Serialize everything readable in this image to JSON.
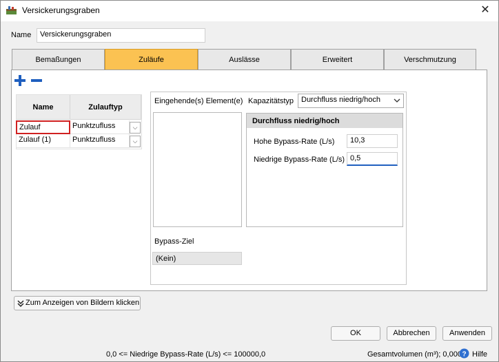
{
  "window": {
    "title": "Versickerungsgraben",
    "app_icon": "package-icon",
    "close": "✕"
  },
  "name_field": {
    "label": "Name",
    "value": "Versickerungsgraben"
  },
  "tabs": [
    {
      "label": "Bemaßungen"
    },
    {
      "label": "Zuläufe"
    },
    {
      "label": "Auslässe"
    },
    {
      "label": "Erweitert"
    },
    {
      "label": "Verschmutzung"
    }
  ],
  "active_tab": "Zuläufe",
  "toolbar": {
    "add": "+",
    "remove": "−"
  },
  "inflow_table": {
    "headers": [
      "Name",
      "Zulauftyp"
    ],
    "rows": [
      {
        "name": "Zulauf",
        "type": "Punktzufluss"
      },
      {
        "name": "Zulauf (1)",
        "type": "Punktzufluss"
      }
    ],
    "dropdown_glyph": "⌵"
  },
  "detail": {
    "incoming_label": "Eingehende(s) Element(e)",
    "capacity_label": "Kapazitätstyp",
    "capacity_value": "Durchfluss niedrig/hoch",
    "group_title": "Durchfluss niedrig/hoch",
    "high_label": "Hohe Bypass-Rate (L/s)",
    "high_value": "10,3",
    "low_label": "Niedrige Bypass-Rate (L/s)",
    "low_value": "0,5",
    "bypass_label": "Bypass-Ziel",
    "bypass_value": "(Kein)"
  },
  "images_button": "Zum Anzeigen von Bildern klicken",
  "buttons": {
    "ok": "OK",
    "cancel": "Abbrechen",
    "apply": "Anwenden"
  },
  "status": {
    "constraint": "0,0 <= Niedrige Bypass-Rate (L/s) <= 100000,0",
    "volume": "Gesamtvolumen (m³); 0,000",
    "help": "Hilfe"
  },
  "colors": {
    "active_tab": "#fbc252",
    "accent_blue": "#1f5fbf",
    "selected_cell_border": "#d02020"
  }
}
